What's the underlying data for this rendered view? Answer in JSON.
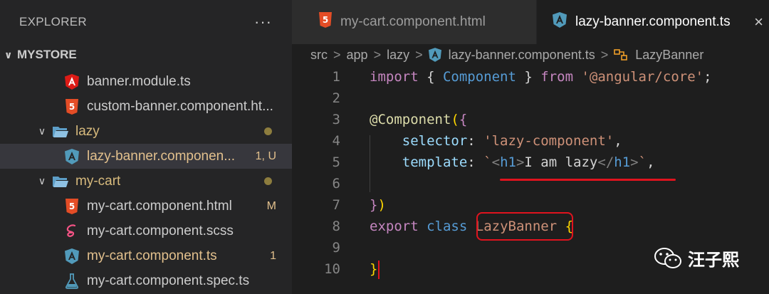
{
  "sidebar": {
    "title": "EXPLORER",
    "more": "···",
    "root_folder": "MYSTORE",
    "items": [
      {
        "label": "banner.module.ts",
        "icon": "angular-icon",
        "badge": ""
      },
      {
        "label": "custom-banner.component.ht...",
        "icon": "html-icon",
        "badge": ""
      },
      {
        "label": "lazy",
        "icon": "folder-open-icon",
        "badge": ""
      },
      {
        "label": "lazy-banner.componen...",
        "icon": "angular-ts-icon",
        "badge": "1, U"
      },
      {
        "label": "my-cart",
        "icon": "folder-open-icon",
        "badge": ""
      },
      {
        "label": "my-cart.component.html",
        "icon": "html-icon",
        "badge": "M"
      },
      {
        "label": "my-cart.component.scss",
        "icon": "sass-icon",
        "badge": ""
      },
      {
        "label": "my-cart.component.ts",
        "icon": "angular-ts-icon",
        "badge": "1"
      },
      {
        "label": "my-cart.component.spec.ts",
        "icon": "test-flask-icon",
        "badge": ""
      }
    ]
  },
  "tabs": [
    {
      "label": "my-cart.component.html",
      "active": false
    },
    {
      "label": "lazy-banner.component.ts",
      "active": true,
      "close": "×"
    }
  ],
  "breadcrumb": {
    "parts": [
      "src",
      "app",
      "lazy",
      "lazy-banner.component.ts",
      "LazyBanner"
    ]
  },
  "editor": {
    "line_numbers": [
      "1",
      "2",
      "3",
      "4",
      "5",
      "6",
      "7",
      "8",
      "9",
      "10"
    ],
    "lines": [
      [
        {
          "t": "import",
          "c": "kw"
        },
        {
          "t": " ",
          "c": "pun"
        },
        {
          "t": "{",
          "c": "pun"
        },
        {
          "t": " Component ",
          "c": "kw2"
        },
        {
          "t": "}",
          "c": "pun"
        },
        {
          "t": " from ",
          "c": "kw"
        },
        {
          "t": "'@angular/core'",
          "c": "str"
        },
        {
          "t": ";",
          "c": "pun"
        }
      ],
      [],
      [
        {
          "t": "@",
          "c": "dec"
        },
        {
          "t": "Component",
          "c": "dec"
        },
        {
          "t": "(",
          "c": "brk"
        },
        {
          "t": "{",
          "c": "kw"
        }
      ],
      [
        {
          "t": "    selector",
          "c": "prop"
        },
        {
          "t": ": ",
          "c": "pun"
        },
        {
          "t": "'lazy-component'",
          "c": "str"
        },
        {
          "t": ",",
          "c": "pun"
        }
      ],
      [
        {
          "t": "    template",
          "c": "prop"
        },
        {
          "t": ": ",
          "c": "pun"
        },
        {
          "t": "`",
          "c": "str"
        },
        {
          "t": "<",
          "c": "tagp"
        },
        {
          "t": "h1",
          "c": "tag"
        },
        {
          "t": ">",
          "c": "tagp"
        },
        {
          "t": "I am lazy",
          "c": "pun"
        },
        {
          "t": "</",
          "c": "tagp"
        },
        {
          "t": "h1",
          "c": "tag"
        },
        {
          "t": ">",
          "c": "tagp"
        },
        {
          "t": "`",
          "c": "str"
        },
        {
          "t": ",",
          "c": "pun"
        }
      ],
      [],
      [
        {
          "t": "}",
          "c": "kw"
        },
        {
          "t": ")",
          "c": "brk"
        }
      ],
      [
        {
          "t": "export",
          "c": "kw"
        },
        {
          "t": " ",
          "c": "pun"
        },
        {
          "t": "class",
          "c": "kw2"
        },
        {
          "t": " ",
          "c": "pun"
        },
        {
          "t": "LazyBanner",
          "c": "str"
        },
        {
          "t": " ",
          "c": "pun"
        },
        {
          "t": "{",
          "c": "brk"
        }
      ],
      [],
      [
        {
          "t": "}",
          "c": "brk"
        }
      ]
    ]
  },
  "watermark": {
    "text": "汪子熙"
  },
  "colors": {
    "accent_red": "#e0131e",
    "angular_blue": "#519aba",
    "html_orange": "#e44d26",
    "folder_blue": "#519aba",
    "modified_yellow": "#e2c08d"
  }
}
